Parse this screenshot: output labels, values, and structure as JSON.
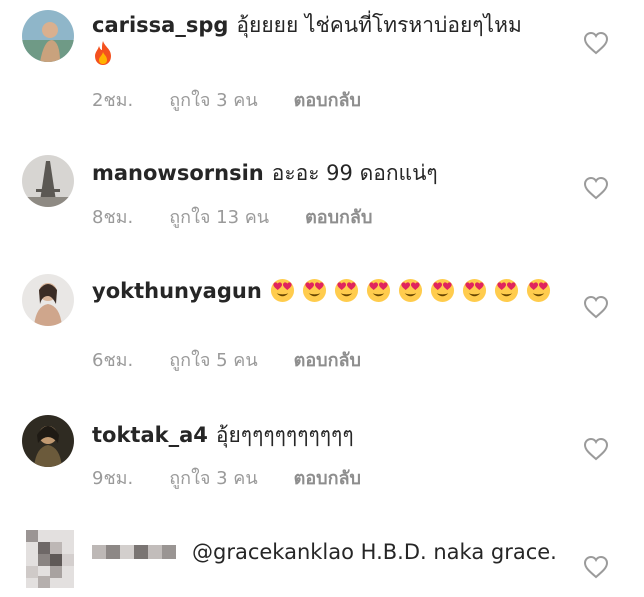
{
  "comments": [
    {
      "username": "carissa_spg",
      "text": "อุ้ยยยย ไช่คนที่โทรหาบ่อยๆไหม",
      "emoji_line": "fire-emoji",
      "time": "2ชม.",
      "likes": "ถูกใจ 3 คน",
      "reply": "ตอบกลับ"
    },
    {
      "username": "manowsornsin",
      "text": "อะอะ 99 ดอกแน่ๆ",
      "time": "8ชม.",
      "likes": "ถูกใจ 13 คน",
      "reply": "ตอบกลับ"
    },
    {
      "username": "yokthunyagun",
      "text": "",
      "emoji_count": 9,
      "emoji_name": "heart-eyes-emoji",
      "time": "6ชม.",
      "likes": "ถูกใจ 5 คน",
      "reply": "ตอบกลับ"
    },
    {
      "username": "toktak_a4",
      "text": "อุ้ยๆๆๆๆๆๆๆๆๆๆ",
      "time": "9ชม.",
      "likes": "ถูกใจ 3 คน",
      "reply": "ตอบกลับ"
    },
    {
      "username": "",
      "mention": "@gracekanklao",
      "text": "H.B.D. naka grace.",
      "blurred": true
    }
  ],
  "icons": {
    "like": "heart-outline-icon"
  },
  "colors": {
    "text": "#262626",
    "meta": "#9a9a9a",
    "heart": "#9b9b9b"
  }
}
